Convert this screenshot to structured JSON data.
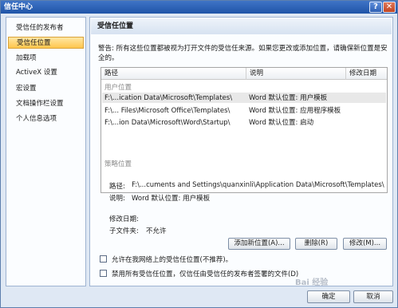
{
  "window": {
    "title": "信任中心",
    "help": "?",
    "close": "✕"
  },
  "sidebar": {
    "items": [
      {
        "label": "受信任的发布者"
      },
      {
        "label": "受信任位置"
      },
      {
        "label": "加载项"
      },
      {
        "label": "ActiveX 设置"
      },
      {
        "label": "宏设置"
      },
      {
        "label": "文档操作栏设置"
      },
      {
        "label": "个人信息选项"
      }
    ]
  },
  "content": {
    "title": "受信任位置",
    "warning": "警告: 所有这些位置都被视为打开文件的受信任来源。如果您更改或添加位置，请确保新位置是安全的。",
    "table": {
      "columns": [
        "路径",
        "说明",
        "修改日期"
      ],
      "user_group": "用户位置",
      "policy_group": "策略位置",
      "rows": [
        {
          "path": "F:\\...ication Data\\Microsoft\\Templates\\",
          "desc": "Word 默认位置: 用户模板",
          "date": ""
        },
        {
          "path": "F:\\... Files\\Microsoft Office\\Templates\\",
          "desc": "Word 默认位置: 应用程序模板",
          "date": ""
        },
        {
          "path": "F:\\...ion Data\\Microsoft\\Word\\Startup\\",
          "desc": "Word 默认位置: 启动",
          "date": ""
        }
      ]
    },
    "details": {
      "path_label": "路径:",
      "path_value": "F:\\...cuments and Settings\\quanxinli\\Application Data\\Microsoft\\Templates\\",
      "desc_label": "说明:",
      "desc_value": "Word 默认位置: 用户模板",
      "date_label": "修改日期:",
      "date_value": "",
      "sub_label": "子文件夹:",
      "sub_value": "不允许"
    },
    "buttons": {
      "add": "添加新位置(A)...",
      "remove": "删除(R)",
      "modify": "修改(M)..."
    },
    "options": {
      "network": "允许在我网络上的受信任位置(不推荐)。",
      "disable": "禁用所有受信任位置，仅信任由受信任的发布者签署的文件(D)"
    }
  },
  "footer": {
    "ok": "确定",
    "cancel": "取消"
  },
  "watermark": "Bai 经验"
}
